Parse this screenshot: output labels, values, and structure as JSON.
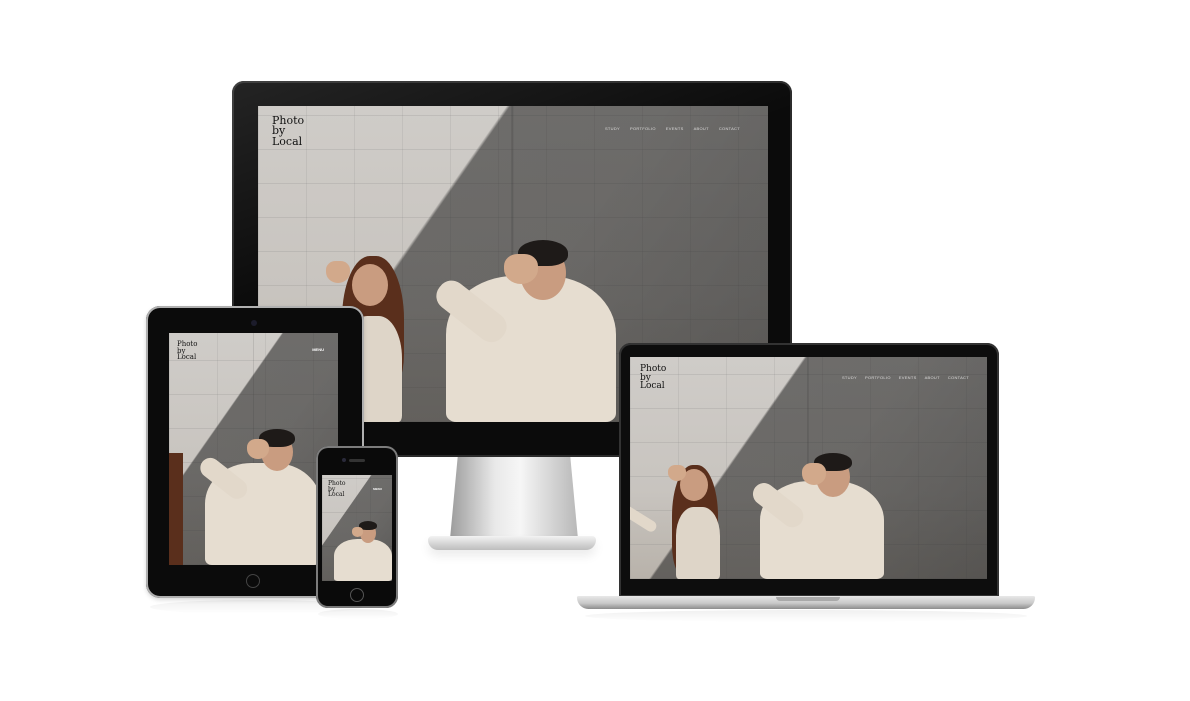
{
  "site": {
    "logo": "Photo\nby\nLocal",
    "nav": [
      "STUDY",
      "PORTFOLIO",
      "EVENTS",
      "ABOUT",
      "CONTACT"
    ],
    "menu_label": "MENU"
  },
  "devices": [
    "monitor",
    "laptop",
    "tablet",
    "phone"
  ],
  "colors": {
    "device_frame": "#0b0b0b",
    "wall": "#cfccc8",
    "sweater": "#e6ddd0",
    "hair": "#5a2f1c"
  }
}
